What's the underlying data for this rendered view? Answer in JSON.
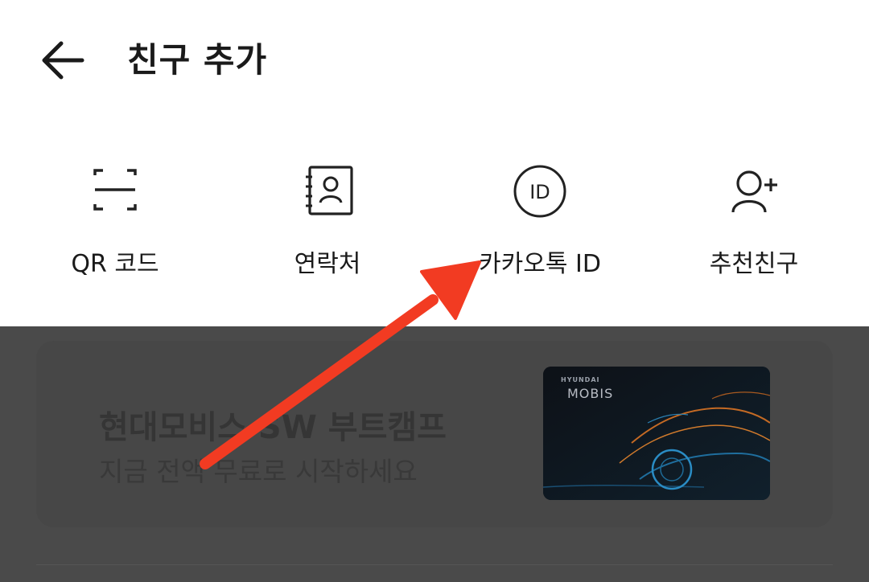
{
  "header": {
    "title": "친구 추가",
    "back_icon": "arrow-left-icon"
  },
  "options": [
    {
      "label": "QR 코드",
      "icon": "qr-scan-icon"
    },
    {
      "label": "연락처",
      "icon": "contacts-book-icon"
    },
    {
      "label": "카카오톡 ID",
      "icon": "id-circle-icon",
      "icon_text": "ID"
    },
    {
      "label": "추천친구",
      "icon": "person-add-icon"
    }
  ],
  "banner": {
    "title": "현대모비스 SW 부트캠프",
    "subtitle": "지금 전액 무료로 시작하세요",
    "image_brand_small": "HYUNDAI",
    "image_brand_main": "MOBIS"
  },
  "colors": {
    "overlay": "#4a4a4a",
    "annotation_arrow": "#f23b22",
    "text": "#1a1a1a"
  }
}
